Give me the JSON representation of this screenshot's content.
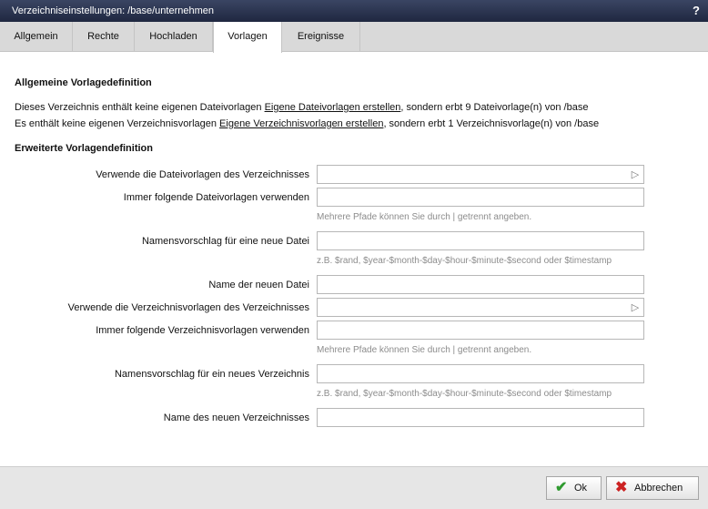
{
  "dialog": {
    "title": "Verzeichniseinstellungen: /base/unternehmen",
    "help": "?"
  },
  "tabs": [
    {
      "label": "Allgemein"
    },
    {
      "label": "Rechte"
    },
    {
      "label": "Hochladen"
    },
    {
      "label": "Vorlagen",
      "active": true
    },
    {
      "label": "Ereignisse"
    }
  ],
  "general": {
    "heading": "Allgemeine Vorlagedefinition",
    "line1": {
      "pre": "Dieses Verzeichnis enthält keine eigenen Dateivorlagen ",
      "link": "Eigene Dateivorlagen erstellen",
      "post": ", sondern erbt 9 Dateivorlage(n) von /base"
    },
    "line2": {
      "pre": "Es enthält keine eigenen Verzeichnisvorlagen ",
      "link": "Eigene Verzeichnisvorlagen erstellen",
      "post": ", sondern erbt 1 Verzeichnisvorlage(n) von /base"
    }
  },
  "extended": {
    "heading": "Erweiterte Vorlagendefinition",
    "fields": [
      {
        "label": "Verwende die Dateivorlagen des Verzeichnisses",
        "value": ""
      },
      {
        "label": "Immer folgende Dateivorlagen verwenden",
        "value": "",
        "hint": "Mehrere Pfade können Sie durch | getrennt angeben."
      },
      {
        "label": "Namensvorschlag für eine neue Datei",
        "value": "",
        "hint": "z.B. $rand, $year-$month-$day-$hour-$minute-$second oder $timestamp"
      },
      {
        "label": "Name der neuen Datei",
        "value": ""
      },
      {
        "label": "Verwende die Verzeichnisvorlagen des Verzeichnisses",
        "value": ""
      },
      {
        "label": "Immer folgende Verzeichnisvorlagen verwenden",
        "value": "",
        "hint": "Mehrere Pfade können Sie durch | getrennt angeben."
      },
      {
        "label": "Namensvorschlag für ein neues Verzeichnis",
        "value": "",
        "hint": "z.B. $rand, $year-$month-$day-$hour-$minute-$second oder $timestamp"
      },
      {
        "label": "Name des neuen Verzeichnisses",
        "value": ""
      }
    ]
  },
  "icons": {
    "dropdown": "cursor-arrow-icon",
    "ok": "check-icon",
    "cancel": "x-icon"
  },
  "buttons": {
    "ok": "Ok",
    "cancel": "Abbrechen"
  },
  "colors": {
    "titlebar": "#2a3350",
    "ok_check": "#2f9a2f",
    "cancel_x": "#cc2222"
  }
}
